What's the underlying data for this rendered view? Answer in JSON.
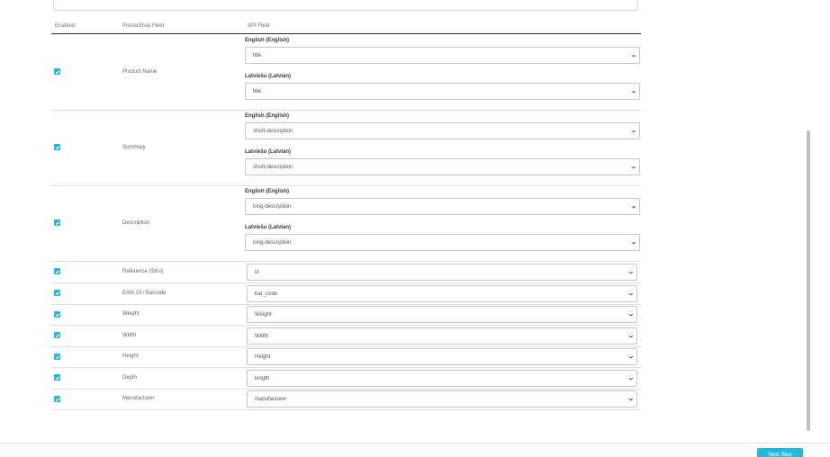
{
  "headers": {
    "enabled": "Enabled",
    "field": "PrestaShop Field",
    "api": "API Field"
  },
  "multi_rows": [
    {
      "name": "Product Name",
      "langs": [
        {
          "label": "English (English)",
          "value": "title"
        },
        {
          "label": "Latviešu (Latvian)",
          "value": "title"
        }
      ]
    },
    {
      "name": "Summary",
      "langs": [
        {
          "label": "English (English)",
          "value": "short-description"
        },
        {
          "label": "Latviešu (Latvian)",
          "value": "short-description"
        }
      ]
    },
    {
      "name": "Description",
      "langs": [
        {
          "label": "English (English)",
          "value": "long-description"
        },
        {
          "label": "Latviešu (Latvian)",
          "value": "long-description"
        }
      ]
    }
  ],
  "single_rows": [
    {
      "name": "Reference (SKU)",
      "value": "id"
    },
    {
      "name": "EAN-13 / Barcode",
      "value": "bar_code"
    },
    {
      "name": "Weight",
      "value": "Weight"
    },
    {
      "name": "Width",
      "value": "Width"
    },
    {
      "name": "Height",
      "value": "Height"
    },
    {
      "name": "Depth",
      "value": "length"
    },
    {
      "name": "Manufacturer",
      "value": "manufacturer"
    }
  ],
  "footer": {
    "next_label": "Next Step"
  },
  "colors": {
    "accent": "#25b9d7"
  }
}
